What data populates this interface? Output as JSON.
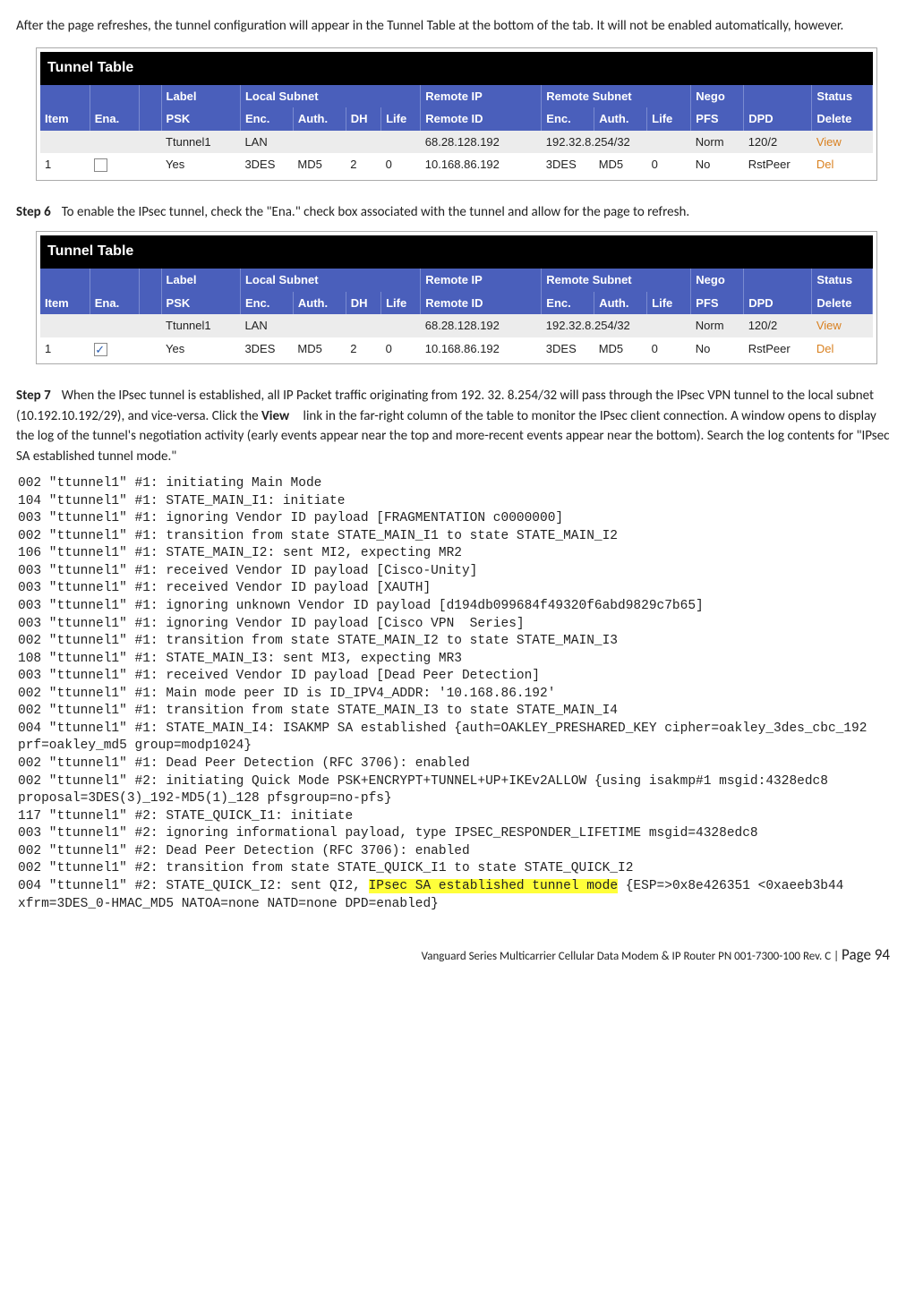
{
  "intro": "After the page refreshes, the tunnel configuration will appear in the Tunnel Table at the bottom of the tab. It will not be enabled automatically, however.",
  "tableTitle": "Tunnel Table",
  "hdr1": {
    "item": "",
    "ena": "",
    "sp1": "",
    "label": "Label",
    "localSubnet": "Local Subnet",
    "remoteIp": "Remote IP",
    "remoteSubnet": "Remote Subnet",
    "nego": "Nego",
    "dpdCol": "",
    "status": "Status"
  },
  "hdr2": {
    "item": "Item",
    "ena": "Ena.",
    "sp1": "",
    "psk": "PSK",
    "enc": "Enc.",
    "auth": "Auth.",
    "dh": "DH",
    "life": "Life",
    "remoteId": "Remote ID",
    "renc": "Enc.",
    "rauth": "Auth.",
    "rlife": "Life",
    "pfs": "PFS",
    "dpd": "DPD",
    "delete": "Delete"
  },
  "t1": {
    "checked": false,
    "rA": {
      "label": "Ttunnel1",
      "localSubnet": "LAN",
      "remoteIp": "68.28.128.192",
      "remoteSubnet": "192.32.8.254/32",
      "nego": "Norm",
      "dpd": "120/2",
      "view": "View"
    },
    "rB": {
      "item": "1",
      "psk": "Yes",
      "enc": "3DES",
      "auth": "MD5",
      "dh": "2",
      "life": "0",
      "remoteId": "10.168.86.192",
      "renc": "3DES",
      "rauth": "MD5",
      "rlife": "0",
      "pfs": "No",
      "dpd": "RstPeer",
      "del": "Del"
    }
  },
  "step6": {
    "label": "Step 6",
    "text": "To enable the IPsec tunnel, check the \"Ena.\" check box associated with the tunnel and allow for the page to refresh."
  },
  "t2": {
    "checked": true,
    "rA": {
      "label": "Ttunnel1",
      "localSubnet": "LAN",
      "remoteIp": "68.28.128.192",
      "remoteSubnet": "192.32.8.254/32",
      "nego": "Norm",
      "dpd": "120/2",
      "view": "View"
    },
    "rB": {
      "item": "1",
      "psk": "Yes",
      "enc": "3DES",
      "auth": "MD5",
      "dh": "2",
      "life": "0",
      "remoteId": "10.168.86.192",
      "renc": "3DES",
      "rauth": "MD5",
      "rlife": "0",
      "pfs": "No",
      "dpd": "RstPeer",
      "del": "Del"
    }
  },
  "step7": {
    "label": "Step 7",
    "t1": "When the IPsec tunnel is established, all IP Packet traffic originating from 192. 32. 8.254/32 will pass through the IPsec VPN tunnel to the local subnet (10.192.10.192/29), and vice-versa. Click the ",
    "viewWord": "View",
    "t2": " link in the far-right column of the table to monitor the IPsec client connection. A window opens to display the log of the tunnel's negotiation activity (early events appear near the top and more-recent events appear near the bottom). Search the log contents for \"IPsec SA established tunnel mode.\""
  },
  "log": {
    "pre1": "002 \"ttunnel1\" #1: initiating Main Mode\n104 \"ttunnel1\" #1: STATE_MAIN_I1: initiate\n003 \"ttunnel1\" #1: ignoring Vendor ID payload [FRAGMENTATION c0000000]\n002 \"ttunnel1\" #1: transition from state STATE_MAIN_I1 to state STATE_MAIN_I2\n106 \"ttunnel1\" #1: STATE_MAIN_I2: sent MI2, expecting MR2\n003 \"ttunnel1\" #1: received Vendor ID payload [Cisco-Unity]\n003 \"ttunnel1\" #1: received Vendor ID payload [XAUTH]\n003 \"ttunnel1\" #1: ignoring unknown Vendor ID payload [d194db099684f49320f6abd9829c7b65]\n003 \"ttunnel1\" #1: ignoring Vendor ID payload [Cisco VPN  Series]\n002 \"ttunnel1\" #1: transition from state STATE_MAIN_I2 to state STATE_MAIN_I3\n108 \"ttunnel1\" #1: STATE_MAIN_I3: sent MI3, expecting MR3\n003 \"ttunnel1\" #1: received Vendor ID payload [Dead Peer Detection]\n002 \"ttunnel1\" #1: Main mode peer ID is ID_IPV4_ADDR: '10.168.86.192'\n002 \"ttunnel1\" #1: transition from state STATE_MAIN_I3 to state STATE_MAIN_I4\n004 \"ttunnel1\" #1: STATE_MAIN_I4: ISAKMP SA established {auth=OAKLEY_PRESHARED_KEY cipher=oakley_3des_cbc_192 prf=oakley_md5 group=modp1024}\n002 \"ttunnel1\" #1: Dead Peer Detection (RFC 3706): enabled\n002 \"ttunnel1\" #2: initiating Quick Mode PSK+ENCRYPT+TUNNEL+UP+IKEv2ALLOW {using isakmp#1 msgid:4328edc8 proposal=3DES(3)_192-MD5(1)_128 pfsgroup=no-pfs}\n117 \"ttunnel1\" #2: STATE_QUICK_I1: initiate\n003 \"ttunnel1\" #2: ignoring informational payload, type IPSEC_RESPONDER_LIFETIME msgid=4328edc8\n002 \"ttunnel1\" #2: Dead Peer Detection (RFC 3706): enabled\n002 \"ttunnel1\" #2: transition from state STATE_QUICK_I1 to state STATE_QUICK_I2\n004 \"ttunnel1\" #2: STATE_QUICK_I2: sent QI2, ",
    "hl": "IPsec SA established tunnel mode",
    "post1": " {ESP=>0x8e426351 <0xaeeb3b44 xfrm=3DES_0-HMAC_MD5 NATOA=none NATD=none DPD=enabled}"
  },
  "footer": {
    "left": "Vanguard Series Multicarrier Cellular Data Modem & IP Router PN 001-7300-100 Rev. C",
    "sep": " | ",
    "page": "Page 94"
  }
}
